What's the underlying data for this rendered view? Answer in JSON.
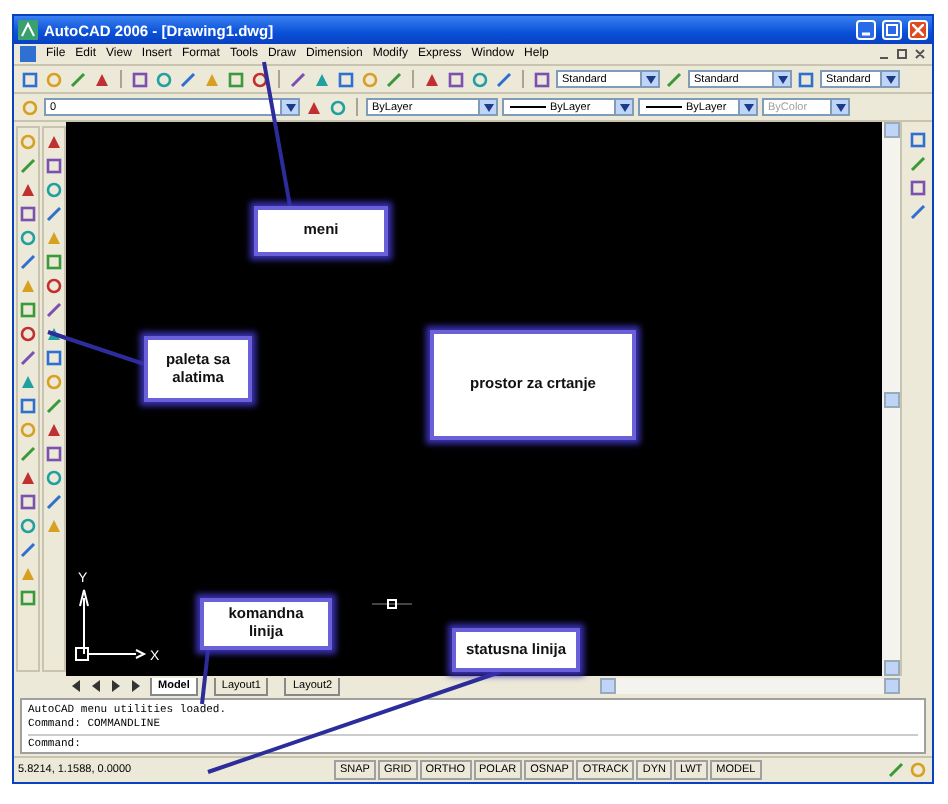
{
  "window": {
    "title": "AutoCAD 2006 - [Drawing1.dwg]"
  },
  "menu": [
    "File",
    "Edit",
    "View",
    "Insert",
    "Format",
    "Tools",
    "Draw",
    "Dimension",
    "Modify",
    "Express",
    "Window",
    "Help"
  ],
  "styles_toolbar": {
    "text_style": "Standard",
    "dimension_style": "Standard",
    "table_style": "Standard"
  },
  "properties_toolbar": {
    "layer": "0",
    "color_control": "ByLayer",
    "linetype": "ByLayer",
    "lineweight": "ByLayer",
    "plot_style": {
      "value": "ByColor",
      "disabled": true
    }
  },
  "drawing": {
    "ucs_labels": [
      "Y",
      "X"
    ]
  },
  "layout_tabs": [
    {
      "label": "Model",
      "selected": true
    },
    {
      "label": "Layout1",
      "selected": false
    },
    {
      "label": "Layout2",
      "selected": false
    }
  ],
  "command_lines": [
    "AutoCAD menu utilities loaded.",
    "Command: COMMANDLINE"
  ],
  "command_prompt": "Command:",
  "status_bar": {
    "coordinates": "5.8214, 1.1588, 0.0000",
    "toggles": [
      "SNAP",
      "GRID",
      "ORTHO",
      "POLAR",
      "OSNAP",
      "OTRACK",
      "DYN",
      "LWT",
      "MODEL"
    ]
  },
  "callouts": [
    {
      "kind": "menu",
      "text": "meni"
    },
    {
      "kind": "palette",
      "text": "paleta sa alatima"
    },
    {
      "kind": "drawing",
      "text": "prostor za crtanje"
    },
    {
      "kind": "command",
      "text": "komandna linija"
    },
    {
      "kind": "status",
      "text": "statusna linija"
    }
  ]
}
